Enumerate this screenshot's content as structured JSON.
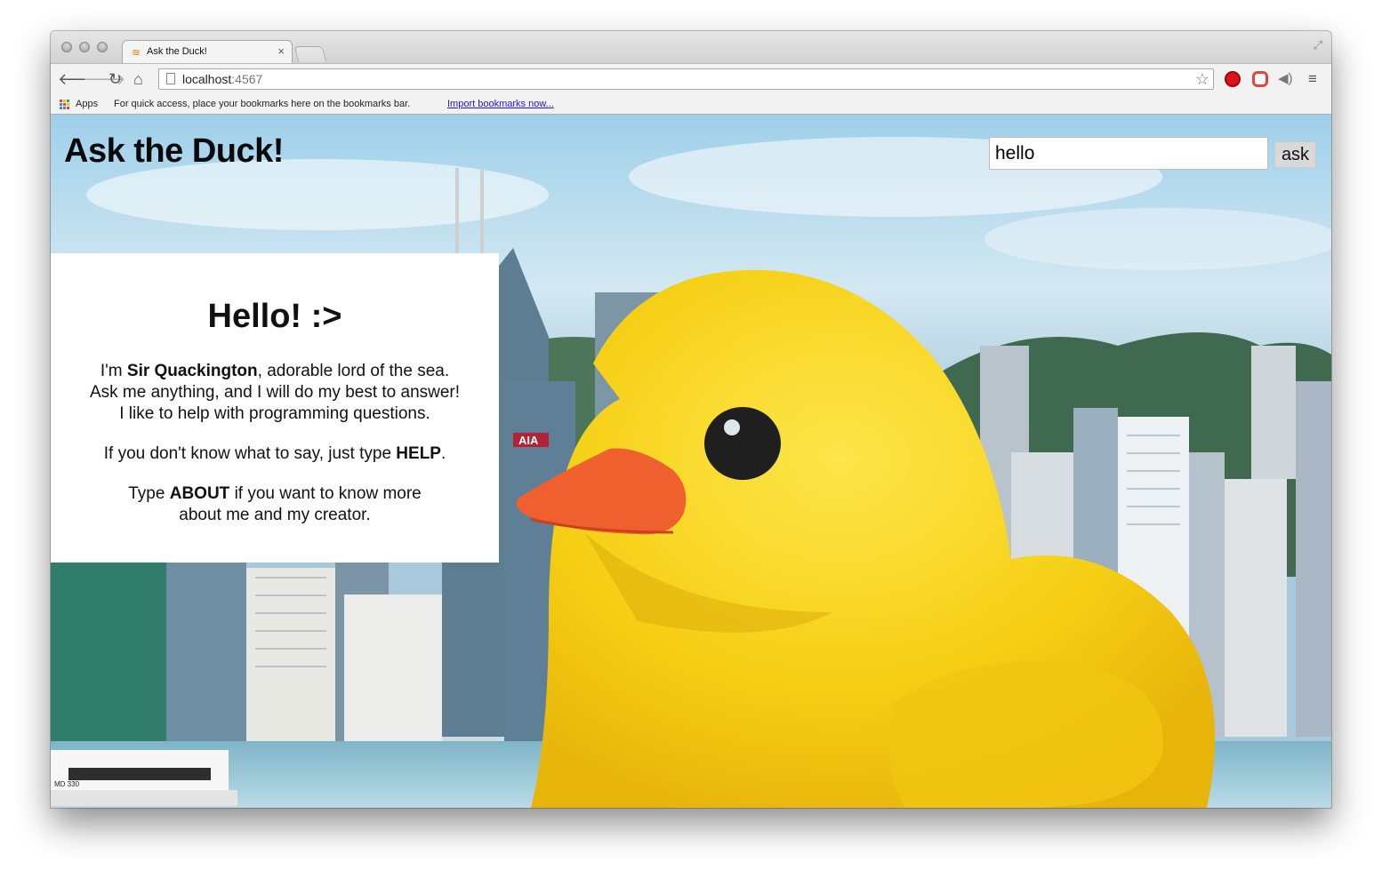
{
  "browser": {
    "tab_title": "Ask the Duck!",
    "tab_close": "×",
    "url_host": "localhost",
    "url_port": ":4567",
    "bookmarks": {
      "apps_label": "Apps",
      "hint": "For quick access, place your bookmarks here on the bookmarks bar.",
      "import_link": "Import bookmarks now..."
    }
  },
  "page": {
    "title": "Ask the Duck!",
    "search": {
      "value": "hello",
      "button_label": "ask"
    },
    "card": {
      "heading": "Hello! :>",
      "intro_prefix": "I'm ",
      "intro_name": "Sir Quackington",
      "intro_suffix": ", adorable lord of the sea.",
      "line2": "Ask me anything, and I will do my best to answer!",
      "line3": "I like to help with programming questions.",
      "help_prefix": "If you don't know what to say, just type ",
      "help_keyword": "HELP",
      "help_suffix": ".",
      "about_prefix": "Type ",
      "about_keyword": "ABOUT",
      "about_suffix": " if you want to know more",
      "about_line2": "about me and my creator."
    },
    "background_image": {
      "banner_text": "AIA",
      "boat_label": "MD 330"
    }
  },
  "colors": {
    "duck_yellow": "#f7d21a",
    "beak_orange": "#f0602f",
    "water": "#8ec3d6",
    "sky": "#b7d9ec",
    "hills": "#3f6a4f"
  },
  "icons": [
    "back-icon",
    "forward-icon",
    "reload-icon",
    "home-icon",
    "page-icon",
    "bookmark-star-icon",
    "extension-icon",
    "menu-icon",
    "apps-icon",
    "favicon-icon"
  ]
}
